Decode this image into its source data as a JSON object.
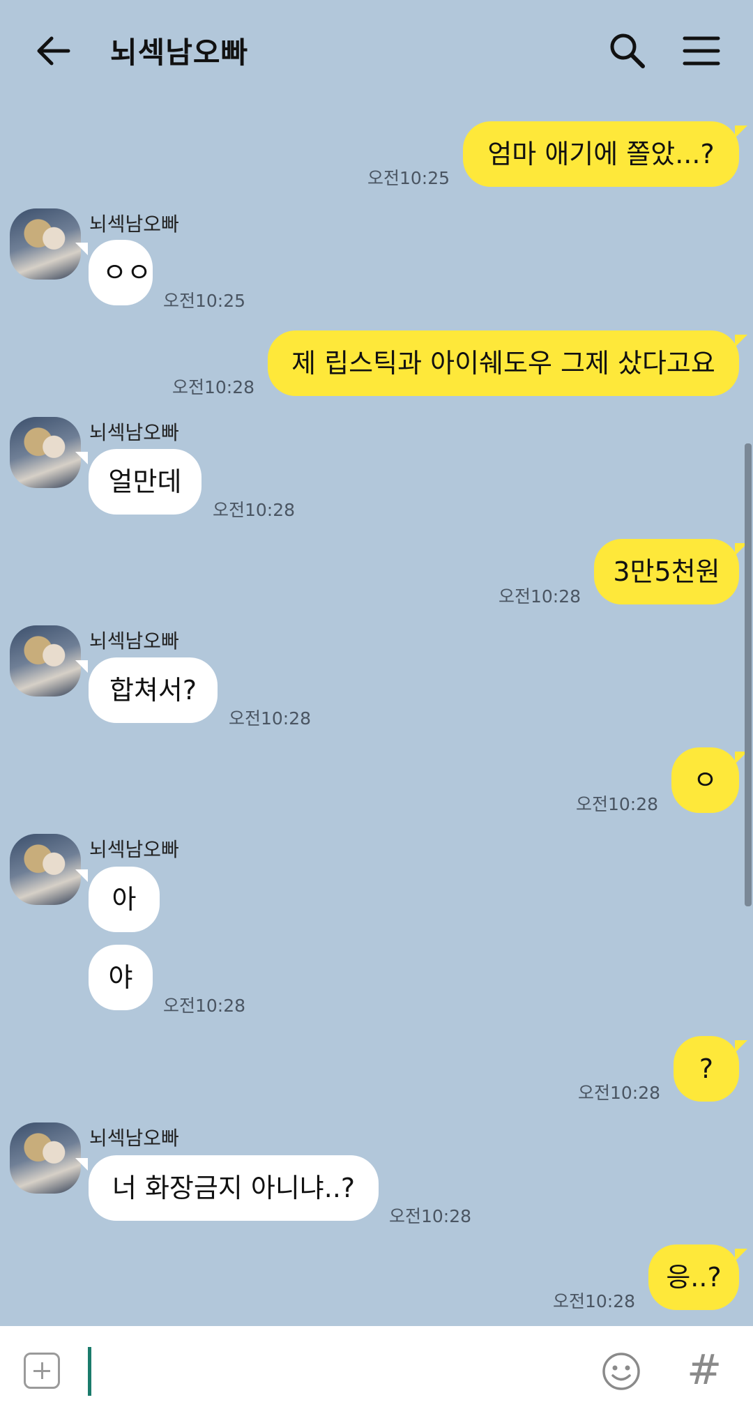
{
  "header": {
    "title": "뇌섹남오빠",
    "back_icon": "arrow-left-icon",
    "search_icon": "search-icon",
    "menu_icon": "hamburger-menu-icon"
  },
  "messages": [
    {
      "from": "me",
      "text": "엄마 애기에 쫄았...?",
      "time": "오전10:25"
    },
    {
      "from": "other",
      "sender": "뇌섹남오빠",
      "text": "ㅇㅇ",
      "time": "오전10:25"
    },
    {
      "from": "me",
      "text": "제 립스틱과 아이쉐도우 그제 샀다고요",
      "time": "오전10:28"
    },
    {
      "from": "other",
      "sender": "뇌섹남오빠",
      "text": "얼만데",
      "time": "오전10:28"
    },
    {
      "from": "me",
      "text": "3만5천원",
      "time": "오전10:28"
    },
    {
      "from": "other",
      "sender": "뇌섹남오빠",
      "text": "합쳐서?",
      "time": "오전10:28"
    },
    {
      "from": "me",
      "text": "ㅇ",
      "time": "오전10:28"
    },
    {
      "from": "other",
      "sender": "뇌섹남오빠",
      "text": "아"
    },
    {
      "from": "other",
      "text": "야",
      "time": "오전10:28"
    },
    {
      "from": "me",
      "text": "?",
      "time": "오전10:28"
    },
    {
      "from": "other",
      "sender": "뇌섹남오빠",
      "text": "너 화장금지 아니냐..?",
      "time": "오전10:28"
    },
    {
      "from": "me",
      "text": "응..?",
      "time": "오전10:28"
    }
  ],
  "input": {
    "placeholder": "",
    "attach_icon": "plus-square-icon",
    "emoji_icon": "smiley-icon",
    "hash_label": "#"
  },
  "colors": {
    "background": "#b2c7da",
    "my_bubble": "#fee83a",
    "other_bubble": "#ffffff",
    "cursor": "#1b7b6b"
  }
}
